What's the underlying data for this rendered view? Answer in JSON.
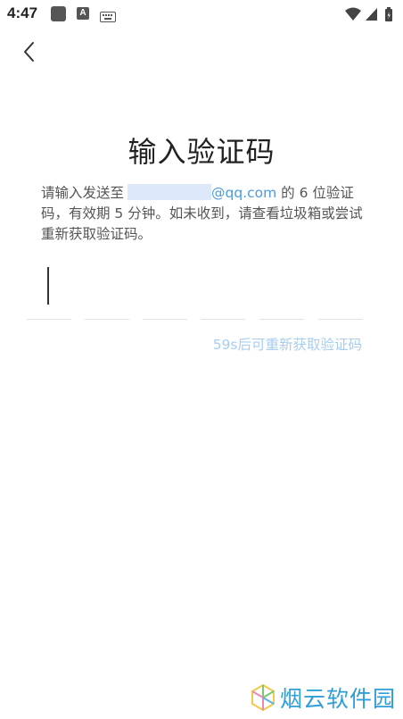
{
  "status_bar": {
    "time": "4:47",
    "a_icon_label": "A"
  },
  "page": {
    "title": "输入验证码",
    "description": {
      "prefix": "请输入发送至",
      "email_domain": "@qq.com",
      "suffix": " 的 6 位验证码，有效期 5 分钟。如未收到，请查看垃圾箱或尝试重新获取验证码。"
    },
    "code_length": 6,
    "resend_label": "59s后可重新获取验证码"
  },
  "watermark": {
    "text": "烟云软件园"
  },
  "colors": {
    "accent": "#4a9be0",
    "resend_disabled": "#a7cdef",
    "email_mask": "#dde9fa"
  }
}
